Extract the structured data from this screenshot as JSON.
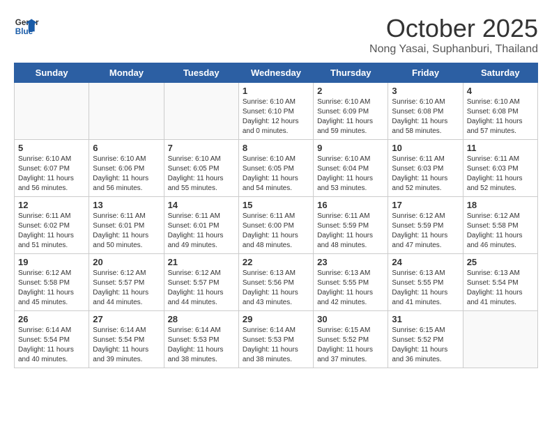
{
  "header": {
    "logo_line1": "General",
    "logo_line2": "Blue",
    "month": "October 2025",
    "location": "Nong Yasai, Suphanburi, Thailand"
  },
  "days_of_week": [
    "Sunday",
    "Monday",
    "Tuesday",
    "Wednesday",
    "Thursday",
    "Friday",
    "Saturday"
  ],
  "weeks": [
    [
      {
        "day": "",
        "info": ""
      },
      {
        "day": "",
        "info": ""
      },
      {
        "day": "",
        "info": ""
      },
      {
        "day": "1",
        "info": "Sunrise: 6:10 AM\nSunset: 6:10 PM\nDaylight: 12 hours\nand 0 minutes."
      },
      {
        "day": "2",
        "info": "Sunrise: 6:10 AM\nSunset: 6:09 PM\nDaylight: 11 hours\nand 59 minutes."
      },
      {
        "day": "3",
        "info": "Sunrise: 6:10 AM\nSunset: 6:08 PM\nDaylight: 11 hours\nand 58 minutes."
      },
      {
        "day": "4",
        "info": "Sunrise: 6:10 AM\nSunset: 6:08 PM\nDaylight: 11 hours\nand 57 minutes."
      }
    ],
    [
      {
        "day": "5",
        "info": "Sunrise: 6:10 AM\nSunset: 6:07 PM\nDaylight: 11 hours\nand 56 minutes."
      },
      {
        "day": "6",
        "info": "Sunrise: 6:10 AM\nSunset: 6:06 PM\nDaylight: 11 hours\nand 56 minutes."
      },
      {
        "day": "7",
        "info": "Sunrise: 6:10 AM\nSunset: 6:05 PM\nDaylight: 11 hours\nand 55 minutes."
      },
      {
        "day": "8",
        "info": "Sunrise: 6:10 AM\nSunset: 6:05 PM\nDaylight: 11 hours\nand 54 minutes."
      },
      {
        "day": "9",
        "info": "Sunrise: 6:10 AM\nSunset: 6:04 PM\nDaylight: 11 hours\nand 53 minutes."
      },
      {
        "day": "10",
        "info": "Sunrise: 6:11 AM\nSunset: 6:03 PM\nDaylight: 11 hours\nand 52 minutes."
      },
      {
        "day": "11",
        "info": "Sunrise: 6:11 AM\nSunset: 6:03 PM\nDaylight: 11 hours\nand 52 minutes."
      }
    ],
    [
      {
        "day": "12",
        "info": "Sunrise: 6:11 AM\nSunset: 6:02 PM\nDaylight: 11 hours\nand 51 minutes."
      },
      {
        "day": "13",
        "info": "Sunrise: 6:11 AM\nSunset: 6:01 PM\nDaylight: 11 hours\nand 50 minutes."
      },
      {
        "day": "14",
        "info": "Sunrise: 6:11 AM\nSunset: 6:01 PM\nDaylight: 11 hours\nand 49 minutes."
      },
      {
        "day": "15",
        "info": "Sunrise: 6:11 AM\nSunset: 6:00 PM\nDaylight: 11 hours\nand 48 minutes."
      },
      {
        "day": "16",
        "info": "Sunrise: 6:11 AM\nSunset: 5:59 PM\nDaylight: 11 hours\nand 48 minutes."
      },
      {
        "day": "17",
        "info": "Sunrise: 6:12 AM\nSunset: 5:59 PM\nDaylight: 11 hours\nand 47 minutes."
      },
      {
        "day": "18",
        "info": "Sunrise: 6:12 AM\nSunset: 5:58 PM\nDaylight: 11 hours\nand 46 minutes."
      }
    ],
    [
      {
        "day": "19",
        "info": "Sunrise: 6:12 AM\nSunset: 5:58 PM\nDaylight: 11 hours\nand 45 minutes."
      },
      {
        "day": "20",
        "info": "Sunrise: 6:12 AM\nSunset: 5:57 PM\nDaylight: 11 hours\nand 44 minutes."
      },
      {
        "day": "21",
        "info": "Sunrise: 6:12 AM\nSunset: 5:57 PM\nDaylight: 11 hours\nand 44 minutes."
      },
      {
        "day": "22",
        "info": "Sunrise: 6:13 AM\nSunset: 5:56 PM\nDaylight: 11 hours\nand 43 minutes."
      },
      {
        "day": "23",
        "info": "Sunrise: 6:13 AM\nSunset: 5:55 PM\nDaylight: 11 hours\nand 42 minutes."
      },
      {
        "day": "24",
        "info": "Sunrise: 6:13 AM\nSunset: 5:55 PM\nDaylight: 11 hours\nand 41 minutes."
      },
      {
        "day": "25",
        "info": "Sunrise: 6:13 AM\nSunset: 5:54 PM\nDaylight: 11 hours\nand 41 minutes."
      }
    ],
    [
      {
        "day": "26",
        "info": "Sunrise: 6:14 AM\nSunset: 5:54 PM\nDaylight: 11 hours\nand 40 minutes."
      },
      {
        "day": "27",
        "info": "Sunrise: 6:14 AM\nSunset: 5:54 PM\nDaylight: 11 hours\nand 39 minutes."
      },
      {
        "day": "28",
        "info": "Sunrise: 6:14 AM\nSunset: 5:53 PM\nDaylight: 11 hours\nand 38 minutes."
      },
      {
        "day": "29",
        "info": "Sunrise: 6:14 AM\nSunset: 5:53 PM\nDaylight: 11 hours\nand 38 minutes."
      },
      {
        "day": "30",
        "info": "Sunrise: 6:15 AM\nSunset: 5:52 PM\nDaylight: 11 hours\nand 37 minutes."
      },
      {
        "day": "31",
        "info": "Sunrise: 6:15 AM\nSunset: 5:52 PM\nDaylight: 11 hours\nand 36 minutes."
      },
      {
        "day": "",
        "info": ""
      }
    ]
  ]
}
